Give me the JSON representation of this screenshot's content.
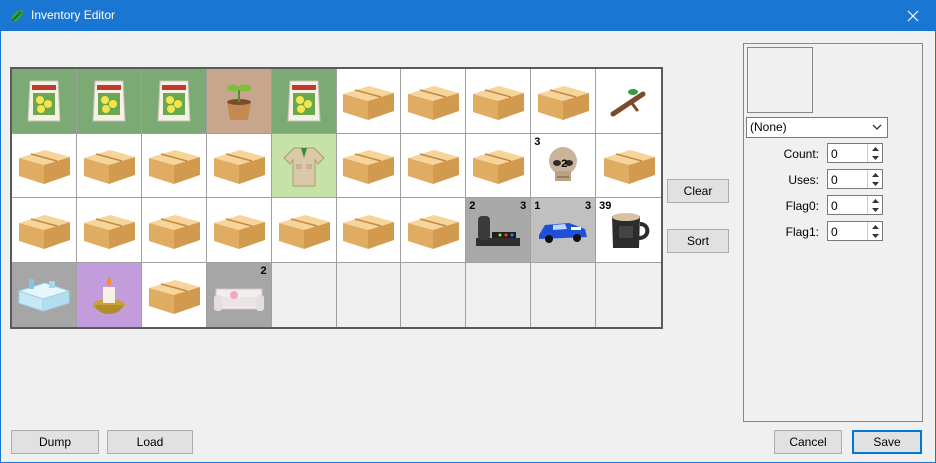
{
  "window": {
    "title": "Inventory Editor",
    "icon": "leaf-icon",
    "close_icon": "close-icon",
    "accent": "#1976d2"
  },
  "inventory": {
    "cells": [
      {
        "item": "flower-seed-bag",
        "bg": "#7caa75"
      },
      {
        "item": "flower-seed-bag",
        "bg": "#7caa75"
      },
      {
        "item": "flower-seed-bag",
        "bg": "#7caa75"
      },
      {
        "item": "sapling-pot",
        "bg": "#c8a58d"
      },
      {
        "item": "flower-seed-bag",
        "bg": "#7caa75"
      },
      {
        "item": "cardboard-box",
        "bg": "#ffffff"
      },
      {
        "item": "cardboard-box",
        "bg": "#ffffff"
      },
      {
        "item": "cardboard-box",
        "bg": "#ffffff"
      },
      {
        "item": "cardboard-box",
        "bg": "#ffffff"
      },
      {
        "item": "tree-branch",
        "bg": "#ffffff"
      },
      {
        "item": "cardboard-box",
        "bg": "#ffffff"
      },
      {
        "item": "cardboard-box",
        "bg": "#ffffff"
      },
      {
        "item": "cardboard-box",
        "bg": "#ffffff"
      },
      {
        "item": "cardboard-box",
        "bg": "#ffffff"
      },
      {
        "item": "explorer-shirt",
        "bg": "#c6e2a6"
      },
      {
        "item": "cardboard-box",
        "bg": "#ffffff"
      },
      {
        "item": "cardboard-box",
        "bg": "#ffffff"
      },
      {
        "item": "cardboard-box",
        "bg": "#ffffff"
      },
      {
        "item": "skull-fossil",
        "bg": "#ffffff",
        "tl": "3",
        "mid": "2"
      },
      {
        "item": "cardboard-box",
        "bg": "#ffffff"
      },
      {
        "item": "cardboard-box",
        "bg": "#ffffff"
      },
      {
        "item": "cardboard-box",
        "bg": "#ffffff"
      },
      {
        "item": "cardboard-box",
        "bg": "#ffffff"
      },
      {
        "item": "cardboard-box",
        "bg": "#ffffff"
      },
      {
        "item": "cardboard-box",
        "bg": "#ffffff"
      },
      {
        "item": "cardboard-box",
        "bg": "#ffffff"
      },
      {
        "item": "cardboard-box",
        "bg": "#ffffff"
      },
      {
        "item": "arcade-machine",
        "bg": "#a9a9a9",
        "tl": "2",
        "tr": "3"
      },
      {
        "item": "race-car",
        "bg": "#c0c0c0",
        "tl": "1",
        "tr": "3"
      },
      {
        "item": "coffee-mug",
        "bg": "#ffffff",
        "tl": "39"
      },
      {
        "item": "ice-table",
        "bg": "#a6a6a6"
      },
      {
        "item": "candle-lamp",
        "bg": "#c39ddb"
      },
      {
        "item": "cardboard-box",
        "bg": "#ffffff"
      },
      {
        "item": "white-sofa",
        "bg": "#a6a6a6",
        "tr": "2"
      },
      {
        "item": "",
        "bg": "#f0f0f0"
      },
      {
        "item": "",
        "bg": "#f0f0f0"
      },
      {
        "item": "",
        "bg": "#f0f0f0"
      },
      {
        "item": "",
        "bg": "#f0f0f0"
      },
      {
        "item": "",
        "bg": "#f0f0f0"
      },
      {
        "item": "",
        "bg": "#f0f0f0"
      }
    ]
  },
  "buttons": {
    "clear": "Clear",
    "sort": "Sort",
    "dump": "Dump",
    "load": "Load",
    "cancel": "Cancel",
    "save": "Save"
  },
  "editor": {
    "item_select": "(None)",
    "count_label": "Count:",
    "count_value": "0",
    "uses_label": "Uses:",
    "uses_value": "0",
    "flag0_label": "Flag0:",
    "flag0_value": "0",
    "flag1_label": "Flag1:",
    "flag1_value": "0"
  }
}
